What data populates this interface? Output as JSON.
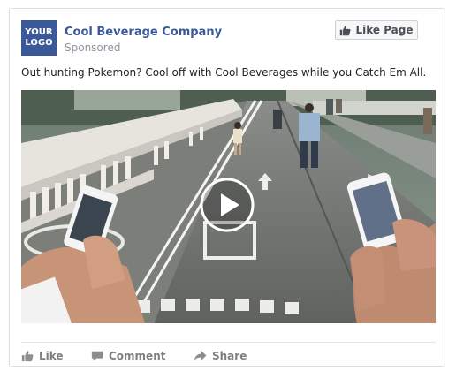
{
  "advertiser": {
    "logo_line1": "YOUR",
    "logo_line2": "LOGO",
    "name": "Cool Beverage Company",
    "sponsored": "Sponsored"
  },
  "like_page_button": {
    "label": "Like Page",
    "icon": "thumbs-up-icon"
  },
  "post": {
    "text": "Out hunting Pokemon? Cool off with Cool Beverages while you Catch Em All.",
    "media": {
      "type": "video",
      "play_icon": "play-icon"
    }
  },
  "actions": [
    {
      "label": "Like",
      "icon": "thumbs-up-icon"
    },
    {
      "label": "Comment",
      "icon": "comment-icon"
    },
    {
      "label": "Share",
      "icon": "share-arrow-icon"
    }
  ],
  "colors": {
    "brand": "#3b5998",
    "muted_text": "#90949c",
    "action_text": "#7f7f7f"
  }
}
